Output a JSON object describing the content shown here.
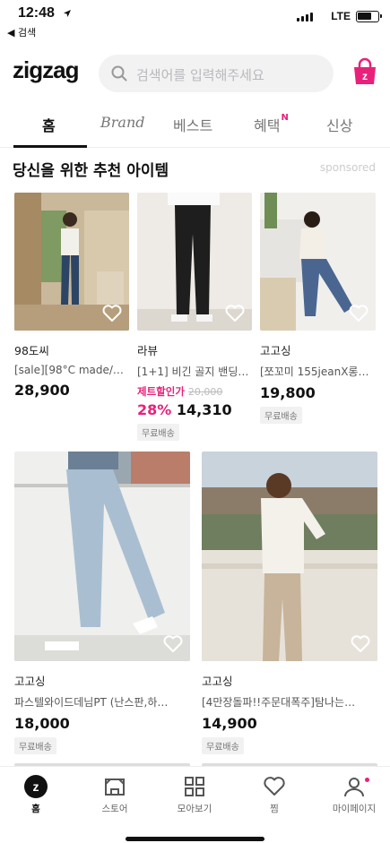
{
  "status_bar": {
    "time": "12:48",
    "back_label": "◀ 검색",
    "network": "LTE"
  },
  "header": {
    "logo": "zigzag",
    "search_placeholder": "검색어를 입력해주세요"
  },
  "tabs": [
    {
      "label": "홈",
      "active": true
    },
    {
      "label": "Brand",
      "active": false
    },
    {
      "label": "베스트",
      "active": false
    },
    {
      "label": "혜택",
      "badge": "N",
      "active": false
    },
    {
      "label": "신상",
      "active": false
    }
  ],
  "section": {
    "title": "당신을 위한 추천 아이템",
    "sponsored": "sponsored"
  },
  "products": [
    {
      "store": "98도씨",
      "name": "[sale][98°C made/2…",
      "price": "28,900"
    },
    {
      "store": "라뷰",
      "name": "[1+1] 비긴 골지 밴딩…",
      "deal_label": "제트할인가",
      "original_price": "20,000",
      "discount": "28%",
      "price": "14,310",
      "shipping": "무료배송"
    },
    {
      "store": "고고싱",
      "name": "[쪼꼬미 155jeanX롱…",
      "price": "19,800",
      "shipping": "무료배송"
    },
    {
      "store": "고고싱",
      "name": "파스텔와이드데님PT (난스판,하…",
      "price": "18,000",
      "shipping": "무료배송"
    },
    {
      "store": "고고싱",
      "name": "[4만장돌파!!주문대폭주]탐나는…",
      "price": "14,900",
      "shipping": "무료배송"
    }
  ],
  "bottom_nav": [
    {
      "label": "홈",
      "icon": "zigzag-home-icon",
      "active": true
    },
    {
      "label": "스토어",
      "icon": "store-icon"
    },
    {
      "label": "모아보기",
      "icon": "grid-icon"
    },
    {
      "label": "찜",
      "icon": "heart-icon"
    },
    {
      "label": "마이페이지",
      "icon": "user-icon",
      "notification": true
    }
  ],
  "colors": {
    "accent": "#e9207a",
    "text": "#111111",
    "muted": "#777777",
    "search_bg": "#f2f2f3"
  }
}
